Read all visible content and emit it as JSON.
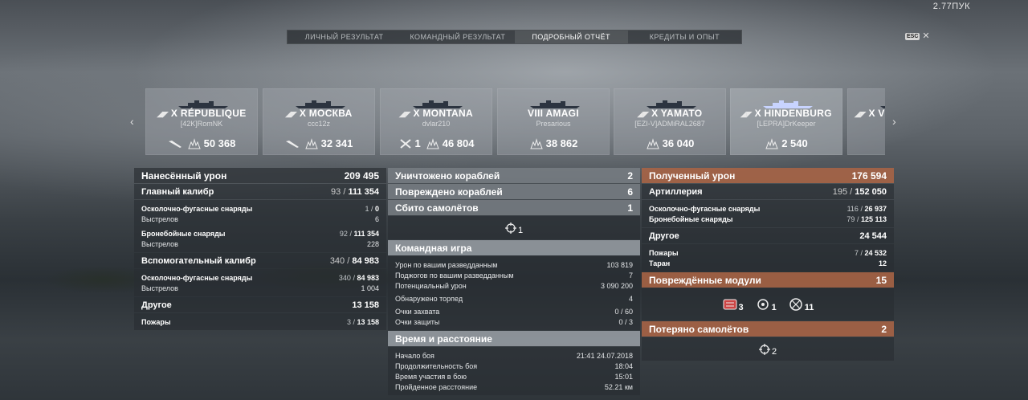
{
  "top_readout": "2.77ПУК",
  "tabs": [
    {
      "label": "ЛИЧНЫЙ РЕЗУЛЬТАТ"
    },
    {
      "label": "КОМАНДНЫЙ РЕЗУЛЬТАТ"
    },
    {
      "label": "ПОДРОБНЫЙ ОТЧЁТ"
    },
    {
      "label": "КРЕДИТЫ И ОПЫТ"
    }
  ],
  "esc": {
    "key": "ESC",
    "close": "✕"
  },
  "carousel": {
    "prev": "‹",
    "next": "›",
    "ships": [
      {
        "tier": "X",
        "name": "RÉPUBLIQUE",
        "player": "[42K]RomNK",
        "icon": "plane-icon",
        "damage": "50 368"
      },
      {
        "tier": "X",
        "name": "МОСКВА",
        "player": "ccc12z",
        "icon": "plane-icon",
        "damage": "32 341"
      },
      {
        "tier": "X",
        "name": "MONTANA",
        "player": "dvlar210",
        "icon": "kill-icon",
        "kills": "1",
        "damage": "46 804"
      },
      {
        "tier": "VIII",
        "name": "AMAGI",
        "player": "Presarious",
        "damage": "38 862"
      },
      {
        "tier": "X",
        "name": "YAMATO",
        "player": "[EZI-V]ADMiRAL2687",
        "damage": "36 040"
      },
      {
        "tier": "X",
        "name": "HINDENBURG",
        "player": "[LEPRA]DrKeeper",
        "damage": "2 540"
      },
      {
        "tier": "X",
        "name": "VI",
        "player": "",
        "damage": ""
      }
    ]
  },
  "col1": {
    "dealt_damage": {
      "label": "Нанесённый урон",
      "value": "209 495"
    },
    "main_battery": {
      "label": "Главный калибр",
      "value_a": "93",
      "value_b": "111 354"
    },
    "main_he": {
      "label": "Осколочно-фугасные снаряды",
      "a": "1",
      "b": "0"
    },
    "main_he_shots": {
      "label": "Выстрелов",
      "value": "6"
    },
    "main_ap": {
      "label": "Бронебойные снаряды",
      "a": "92",
      "b": "111 354"
    },
    "main_ap_shots": {
      "label": "Выстрелов",
      "value": "228"
    },
    "secondary": {
      "label": "Вспомогательный калибр",
      "value_a": "340",
      "value_b": "84 983"
    },
    "sec_he": {
      "label": "Осколочно-фугасные снаряды",
      "a": "340",
      "b": "84 983"
    },
    "sec_he_shots": {
      "label": "Выстрелов",
      "value": "1 004"
    },
    "other": {
      "label": "Другое",
      "value": "13 158"
    },
    "fires": {
      "label": "Пожары",
      "a": "3",
      "b": "13 158"
    }
  },
  "col2": {
    "ships_destroyed": {
      "label": "Уничтожено кораблей",
      "value": "2"
    },
    "ships_damaged": {
      "label": "Повреждено кораблей",
      "value": "6"
    },
    "planes_shot": {
      "label": "Сбито самолётов",
      "value": "1"
    },
    "planes_center": "1",
    "team_play": {
      "label": "Командная игра"
    },
    "team_rows": [
      {
        "label": "Урон по вашим разведданным",
        "value": "103 819"
      },
      {
        "label": "Поджогов по вашим разведданным",
        "value": "7"
      },
      {
        "label": "Потенциальный урон",
        "value": "3 090 200"
      },
      {
        "label": "Обнаружено торпед",
        "value": "4"
      },
      {
        "label": "Очки захвата",
        "value": "0 / 60"
      },
      {
        "label": "Очки защиты",
        "value": "0 / 3"
      }
    ],
    "time_dist": {
      "label": "Время и расстояние"
    },
    "time_rows": [
      {
        "label": "Начало боя",
        "value": "21:41  24.07.2018"
      },
      {
        "label": "Продолжительность боя",
        "value": "18:04"
      },
      {
        "label": "Время участия в бою",
        "value": "15:01"
      },
      {
        "label": "Пройденное расстояние",
        "value": "52.21 км"
      }
    ]
  },
  "col3": {
    "received": {
      "label": "Полученный урон",
      "value": "176 594"
    },
    "artillery": {
      "label": "Артиллерия",
      "value_a": "195",
      "value_b": "152 050"
    },
    "art_he": {
      "label": "Осколочно-фугасные снаряды",
      "a": "116",
      "b": "26 937"
    },
    "art_ap": {
      "label": "Бронебойные снаряды",
      "a": "79",
      "b": "125 113"
    },
    "other": {
      "label": "Другое",
      "value": "24 544"
    },
    "fires": {
      "label": "Пожары",
      "a": "7",
      "b": "24 532"
    },
    "ram": {
      "label": "Таран",
      "value": "12"
    },
    "modules": {
      "label": "Повреждённые модули",
      "value": "15"
    },
    "module_items": [
      {
        "icon": "gun-module-icon",
        "count": "3"
      },
      {
        "icon": "engine-module-icon",
        "count": "1"
      },
      {
        "icon": "aa-module-icon",
        "count": "11"
      }
    ],
    "planes_lost": {
      "label": "Потеряно самолётов",
      "value": "2"
    },
    "planes_center": "2"
  }
}
